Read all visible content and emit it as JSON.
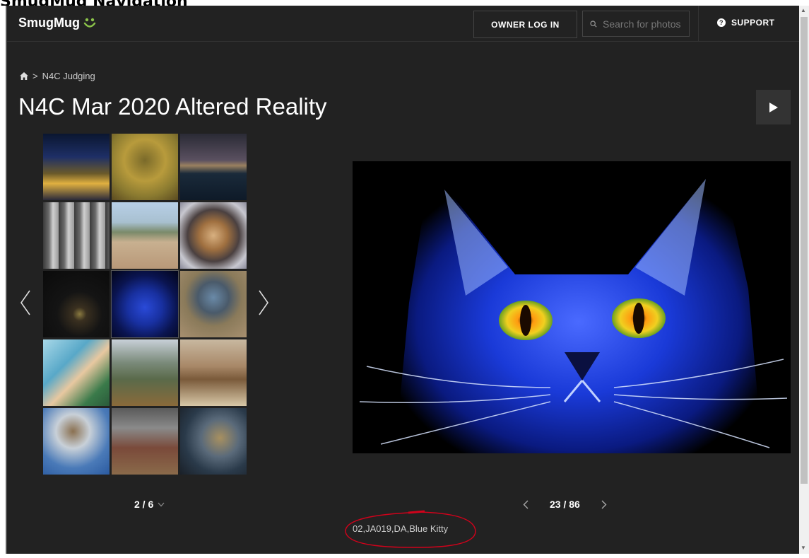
{
  "outer": {
    "title": "SmugMug Navigation"
  },
  "header": {
    "logo_text": "SmugMug",
    "owner_login_label": "OWNER LOG IN",
    "search_placeholder": "Search for photos",
    "support_label": "SUPPORT"
  },
  "breadcrumb": {
    "home_icon": "home-icon",
    "separator": ">",
    "item": "N4C Judging"
  },
  "gallery": {
    "title": "N4C Mar 2020 Altered Reality",
    "page_indicator": "2 / 6",
    "photo_counter": "23 / 86",
    "caption": "02,JA019,DA,Blue Kitty"
  },
  "colors": {
    "background": "#222222",
    "accent_logo": "#8bc34a",
    "annotation": "#d0021b"
  },
  "icons": [
    "home-icon",
    "search-icon",
    "help-icon",
    "play-icon",
    "chevron-left-icon",
    "chevron-right-icon",
    "chevron-down-icon",
    "smile-logo-icon"
  ]
}
